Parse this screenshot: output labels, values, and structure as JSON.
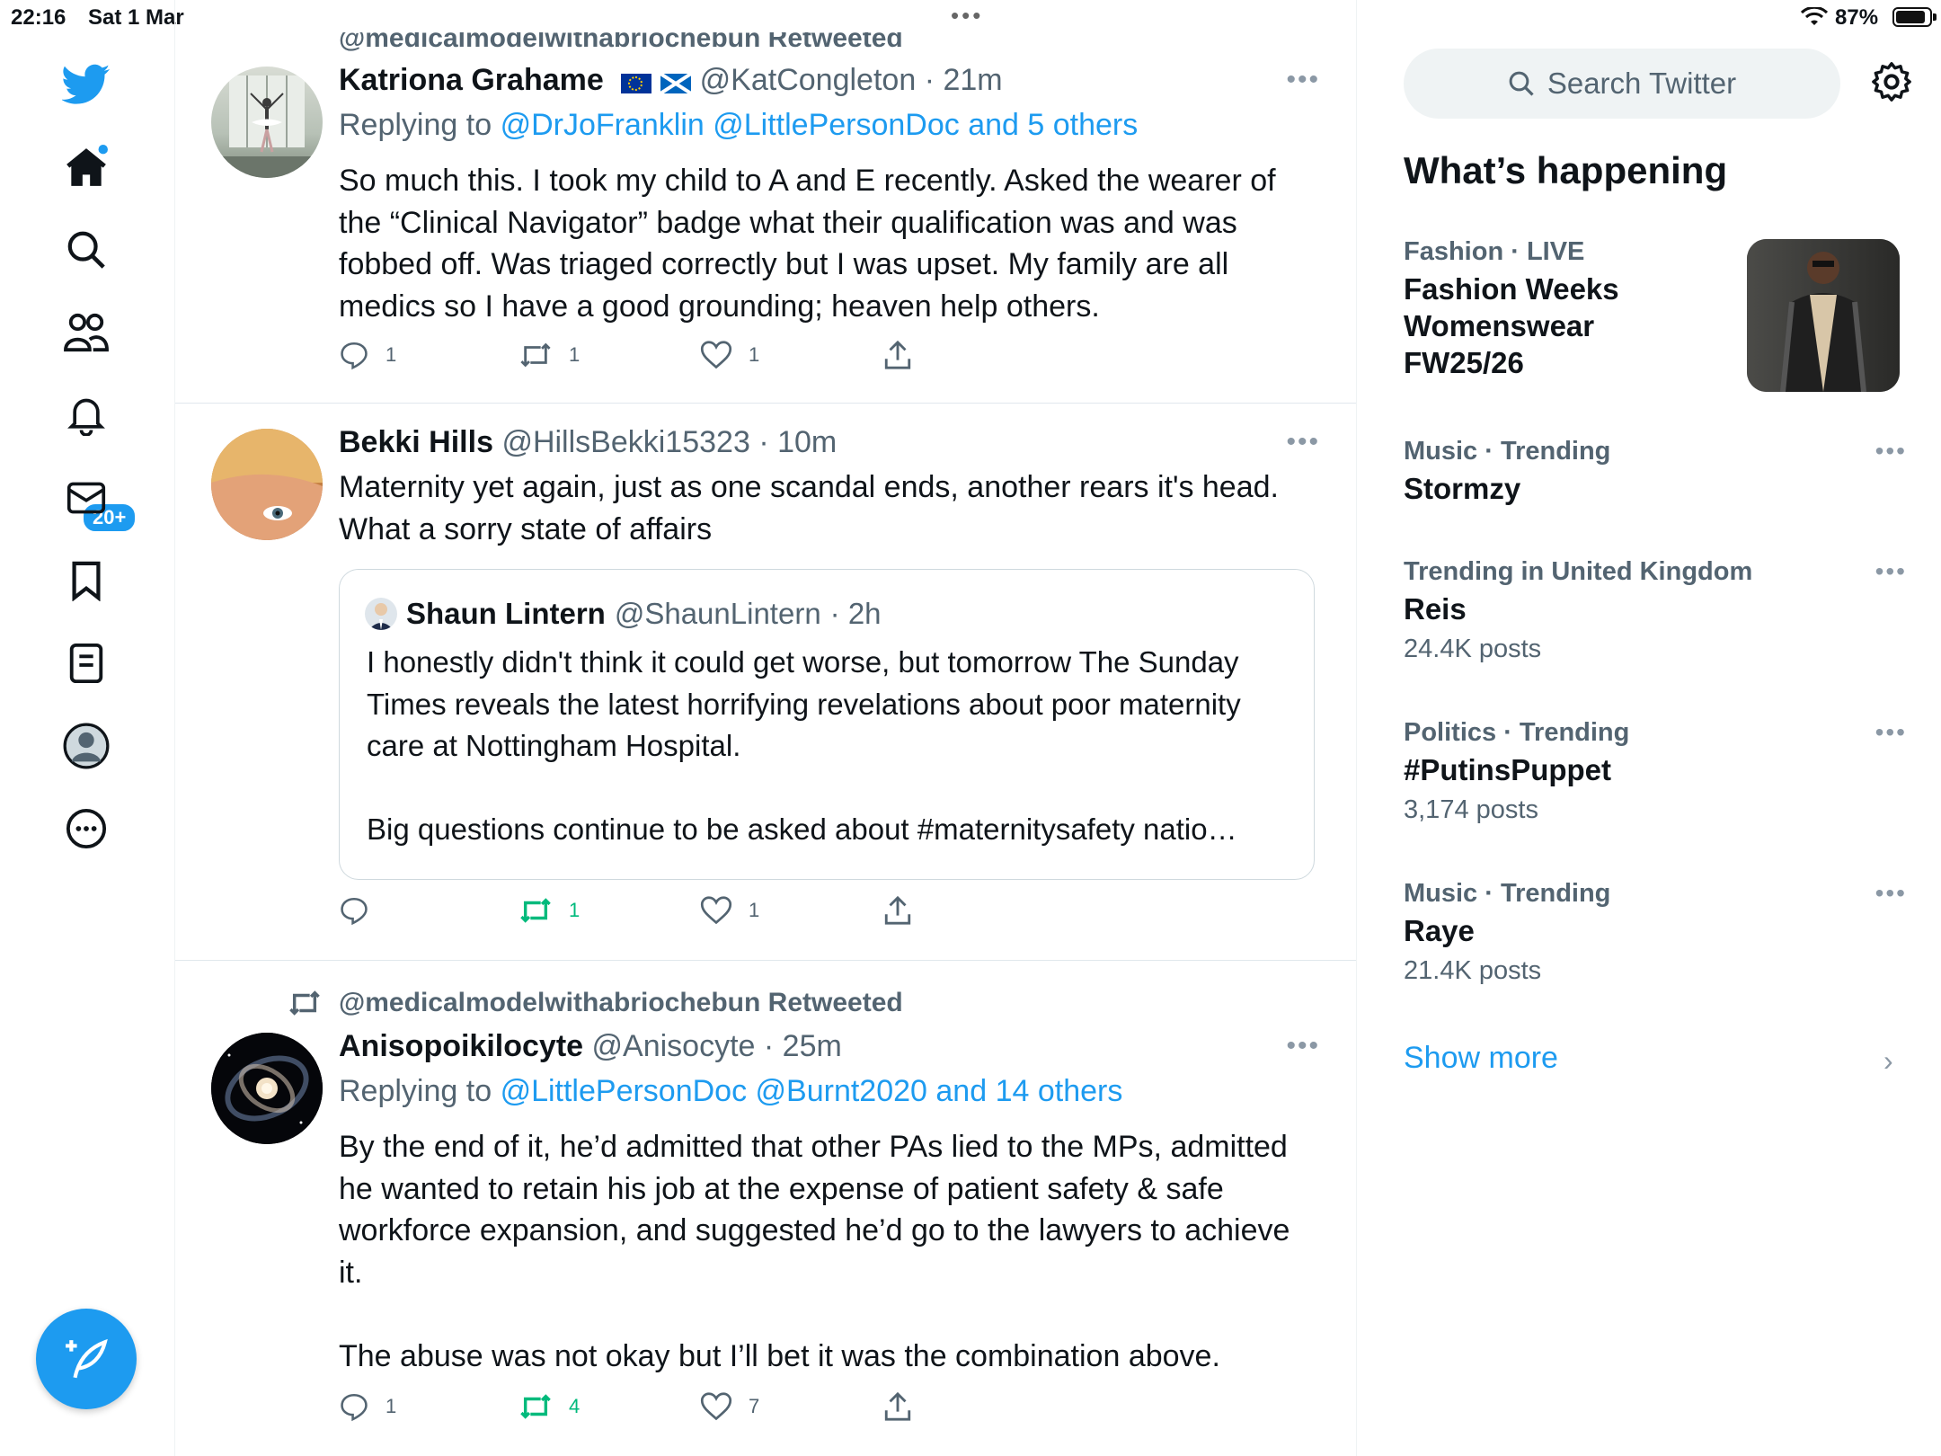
{
  "status_bar": {
    "time": "22:16",
    "date": "Sat 1 Mar",
    "battery": "87%"
  },
  "nav": {
    "notifications_badge": "20+"
  },
  "tweets": [
    {
      "retweet_label": "@medicalmodelwithabriochebun Retweeted",
      "name": "Katriona Grahame",
      "flags": "🇪🇺 🏴",
      "handle": "@KatCongleton",
      "time": "· 21m",
      "reply_prefix": "Replying to",
      "reply_targets": "@DrJoFranklin @LittlePersonDoc and 5 others",
      "body": [
        "So much this. I took my child to A and E recently. Asked the wearer of",
        "the “Clinical Navigator” badge what their qualification was and was",
        "fobbed off. Was triaged correctly but I was upset. My family are all",
        "medics so I have a good grounding; heaven help others."
      ],
      "replies": "1",
      "retweets": "1",
      "likes": "1"
    },
    {
      "name": "Bekki Hills",
      "handle": "@HillsBekki15323",
      "time": "· 10m",
      "body": [
        "Maternity yet again, just as one scandal ends, another rears it's head.",
        "What a sorry state of affairs"
      ],
      "quote": {
        "name": "Shaun Lintern",
        "handle": "@ShaunLintern",
        "time": "· 2h",
        "body": [
          "I honestly didn't think it could get worse, but tomorrow The Sunday",
          "Times reveals the latest horrifying revelations about poor maternity",
          "care at Nottingham Hospital.",
          "",
          "Big questions continue to be asked about #maternitysafety natio…"
        ]
      },
      "replies": "",
      "retweets": "1",
      "likes": "1"
    },
    {
      "retweet_label": "@medicalmodelwithabriochebun Retweeted",
      "name": "Anisopoikilocyte",
      "handle": "@Anisocyte",
      "time": "· 25m",
      "reply_prefix": "Replying to",
      "reply_targets": "@LittlePersonDoc @Burnt2020 and 14 others",
      "body": [
        "By the end of it, he’d admitted that other PAs lied to the MPs, admitted",
        "he wanted to retain his job at the expense of patient safety & safe",
        "workforce expansion, and suggested he’d go to the lawyers to achieve",
        "it.",
        "",
        "The abuse was not okay but I’ll bet it was the combination above."
      ],
      "replies": "1",
      "retweets": "4",
      "likes": "7"
    }
  ],
  "sidebar": {
    "search_placeholder": "Search Twitter",
    "heading": "What’s happening",
    "trends": [
      {
        "meta": "Fashion · LIVE",
        "title": "Fashion Weeks\nWomenswear\nFW25/26",
        "count": ""
      },
      {
        "meta": "Music · Trending",
        "title": "Stormzy",
        "count": ""
      },
      {
        "meta": "Trending in United Kingdom",
        "title": "Reis",
        "count": "24.4K posts"
      },
      {
        "meta": "Politics · Trending",
        "title": "#PutinsPuppet",
        "count": "3,174 posts"
      },
      {
        "meta": "Music · Trending",
        "title": "Raye",
        "count": "21.4K posts"
      }
    ],
    "show_more": "Show more"
  },
  "colors": {
    "accent": "#1d9bf0",
    "retweet_green": "#00ba7c",
    "secondary_text": "#536471"
  }
}
